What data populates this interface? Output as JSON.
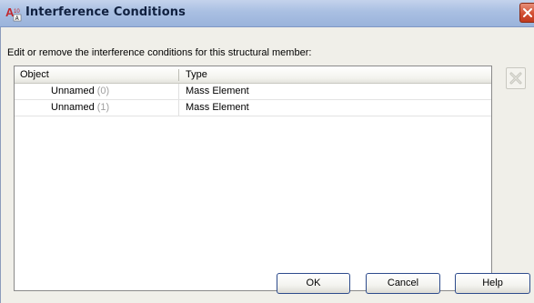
{
  "window": {
    "title": "Interference Conditions",
    "app_icon": "autocad-architecture-icon",
    "close_icon": "close-icon"
  },
  "prompt": "Edit or remove the interference conditions for this structural member:",
  "table": {
    "columns": [
      "Object",
      "Type"
    ],
    "rows": [
      {
        "name": "Unnamed",
        "index": "(0)",
        "type": "Mass Element"
      },
      {
        "name": "Unnamed",
        "index": "(1)",
        "type": "Mass Element"
      }
    ]
  },
  "side_actions": {
    "delete_icon": "delete-x-icon"
  },
  "buttons": {
    "ok": "OK",
    "cancel": "Cancel",
    "help": "Help"
  },
  "colors": {
    "titlebar": "#a9bfe2",
    "close": "#d24f33",
    "dialog_bg": "#f0efe9",
    "index_gray": "#a0a0a0"
  }
}
